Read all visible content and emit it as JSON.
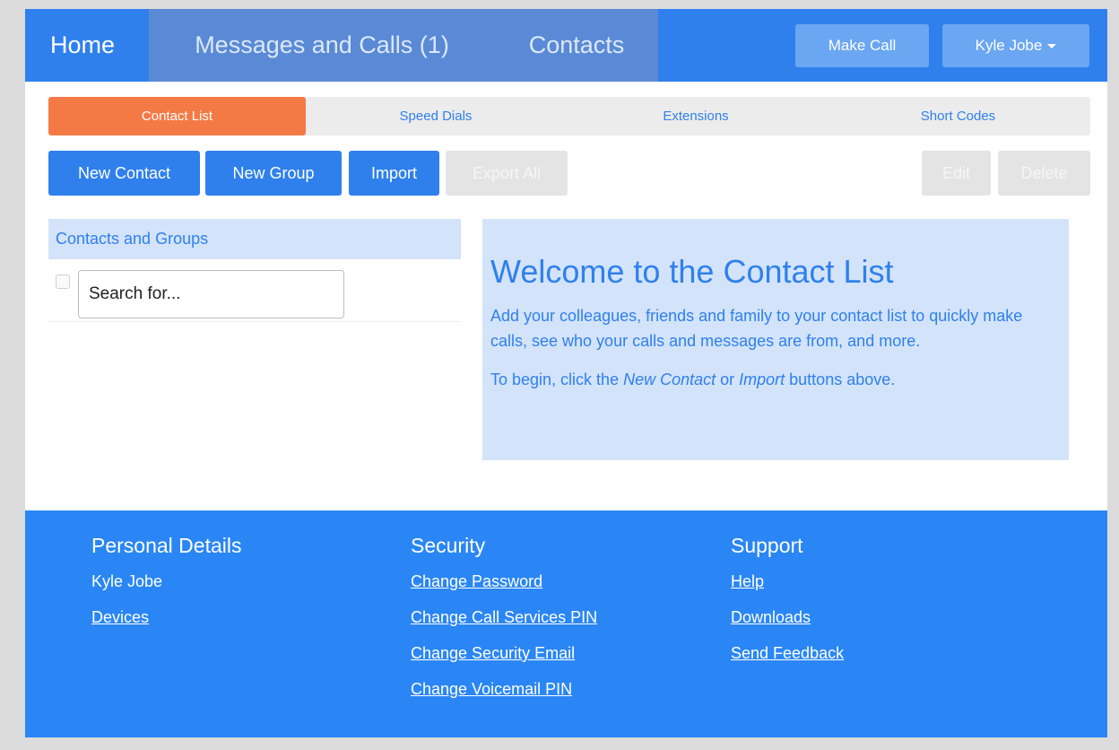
{
  "nav": {
    "home": "Home",
    "messages": "Messages and Calls (1)",
    "contacts": "Contacts",
    "make_call": "Make Call",
    "user": "Kyle Jobe"
  },
  "tabs": [
    {
      "label": "Contact List",
      "active": true
    },
    {
      "label": "Speed Dials",
      "active": false
    },
    {
      "label": "Extensions",
      "active": false
    },
    {
      "label": "Short Codes",
      "active": false
    }
  ],
  "actions": {
    "new_contact": "New Contact",
    "new_group": "New Group",
    "import": "Import",
    "export_all": "Export All",
    "edit": "Edit",
    "delete": "Delete"
  },
  "left_panel": {
    "header": "Contacts and Groups",
    "search_placeholder": "Search for..."
  },
  "welcome": {
    "title": "Welcome to the Contact List",
    "paragraph1": "Add your colleagues, friends and family to your contact list to quickly make calls, see who your calls and messages are from, and more.",
    "p2_prefix": "To begin, click the ",
    "p2_em1": "New Contact",
    "p2_mid": " or ",
    "p2_em2": "Import",
    "p2_suffix": " buttons above."
  },
  "footer": {
    "personal": {
      "heading": "Personal Details",
      "name": "Kyle Jobe",
      "devices": "Devices"
    },
    "security": {
      "heading": "Security",
      "links": [
        "Change Password",
        "Change Call Services PIN",
        "Change Security Email",
        "Change Voicemail PIN"
      ]
    },
    "support": {
      "heading": "Support",
      "links": [
        "Help",
        "Downloads",
        "Send Feedback"
      ]
    }
  },
  "colors": {
    "brand_blue": "#2f80ed",
    "active_tab": "#f47a45",
    "panel_bg": "#d3e3f9"
  }
}
